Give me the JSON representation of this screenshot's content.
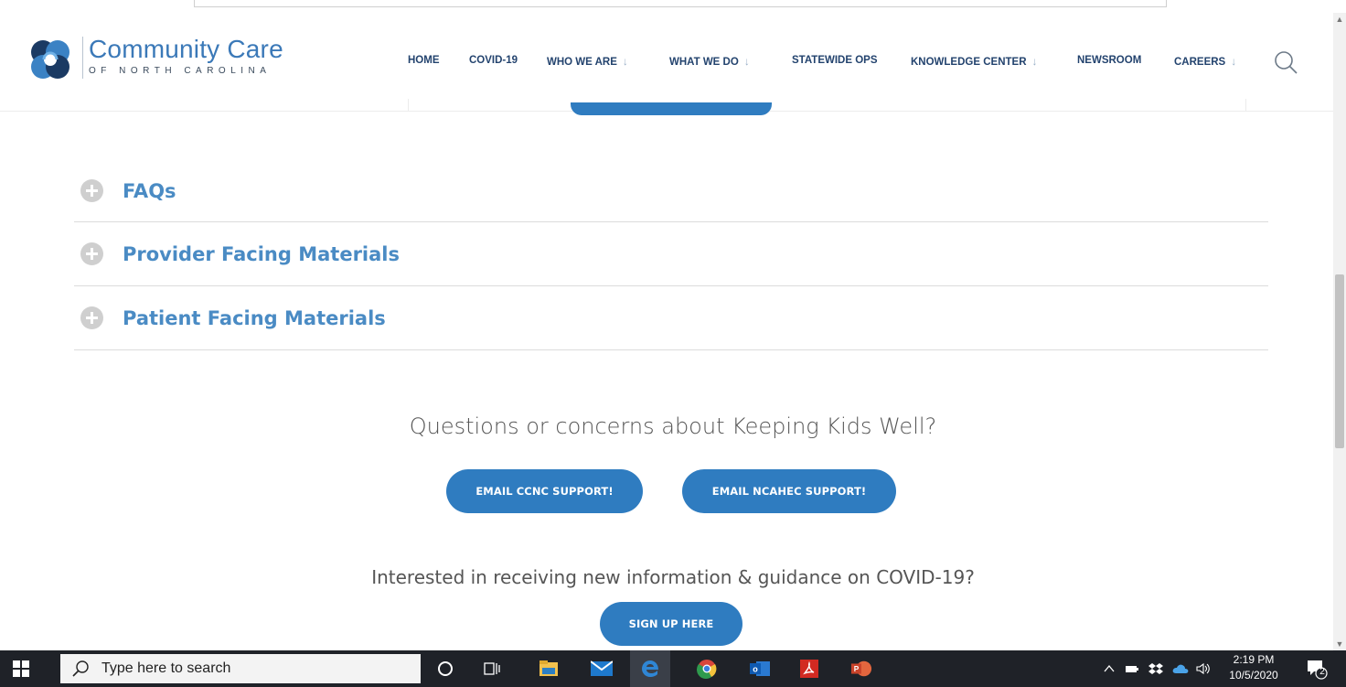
{
  "brand": {
    "name": "Community Care",
    "subtitle": "OF NORTH CAROLINA",
    "colors": {
      "primary": "#2f7cc0",
      "nav_text": "#23436e",
      "accordion_text": "#4a8bc4"
    }
  },
  "nav": {
    "items": [
      {
        "label": "HOME",
        "has_dropdown": false
      },
      {
        "label": "COVID-19",
        "has_dropdown": false
      },
      {
        "label": "WHO WE ARE",
        "has_dropdown": true
      },
      {
        "label": "WHAT WE DO",
        "has_dropdown": true
      },
      {
        "label": "STATEWIDE OPS",
        "has_dropdown": false
      },
      {
        "label": "KNOWLEDGE CENTER",
        "has_dropdown": true
      },
      {
        "label": "NEWSROOM",
        "has_dropdown": false
      },
      {
        "label": "CAREERS",
        "has_dropdown": true
      }
    ],
    "dropdown_caret": "↓",
    "search_icon": "search-icon"
  },
  "accordion": {
    "items": [
      {
        "label": "FAQs"
      },
      {
        "label": "Provider Facing Materials"
      },
      {
        "label": "Patient Facing Materials"
      }
    ]
  },
  "contact": {
    "heading": "Questions or concerns about Keeping Kids Well?",
    "email_ccnc": "EMAIL CCNC SUPPORT!",
    "email_ncahec": "EMAIL NCAHEC SUPPORT!"
  },
  "signup": {
    "heading": "Interested in receiving new information & guidance on COVID-19?",
    "button": "SIGN UP HERE"
  },
  "taskbar": {
    "search_placeholder": "Type here to search",
    "time": "2:19 PM",
    "date": "10/5/2020",
    "notification_count": "2",
    "pinned": [
      "cortana-icon",
      "task-view-icon",
      "file-explorer-icon",
      "mail-icon",
      "edge-icon",
      "chrome-icon",
      "outlook-icon",
      "acrobat-icon",
      "powerpoint-icon"
    ]
  }
}
